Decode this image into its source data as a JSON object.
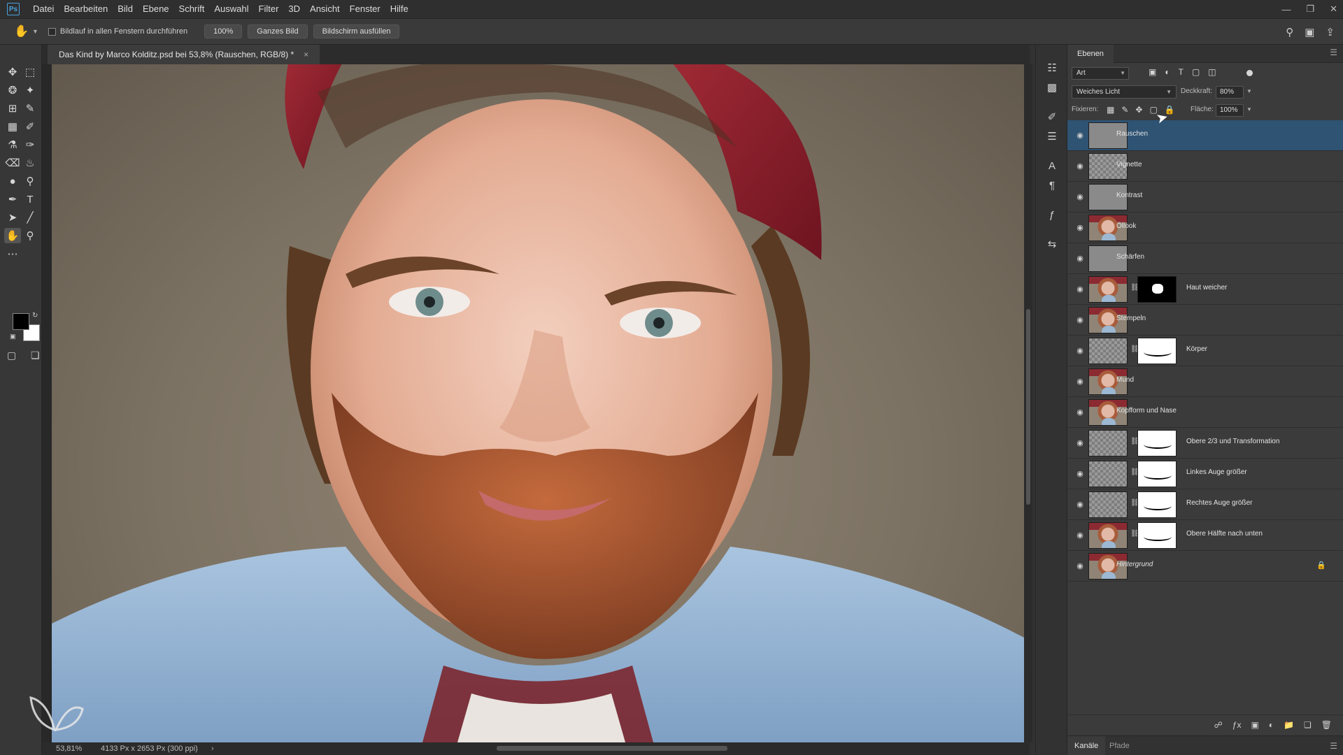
{
  "app": {
    "logo": "Ps"
  },
  "menu": [
    "Datei",
    "Bearbeiten",
    "Bild",
    "Ebene",
    "Schrift",
    "Auswahl",
    "Filter",
    "3D",
    "Ansicht",
    "Fenster",
    "Hilfe"
  ],
  "options": {
    "scroll_all_label": "Bildlauf in allen Fenstern durchführen",
    "zoom_btn": "100%",
    "fit_btn": "Ganzes Bild",
    "fill_btn": "Bildschirm ausfüllen"
  },
  "document": {
    "tab_title": "Das Kind by Marco Kolditz.psd bei 53,8% (Rauschen, RGB/8) *",
    "close": "×"
  },
  "status": {
    "zoom": "53,81%",
    "doc_info": "4133 Px x 2653 Px (300 ppi)"
  },
  "layers_panel": {
    "tab": "Ebenen",
    "filter_kind": "Art",
    "blend_mode": "Weiches Licht",
    "opacity_label": "Deckkraft:",
    "opacity_value": "80%",
    "lock_label": "Fixieren:",
    "fill_label": "Fläche:",
    "fill_value": "100%",
    "layers": [
      {
        "name": "Rauschen",
        "thumb": "gray",
        "mask": null,
        "selected": true
      },
      {
        "name": "Vignette",
        "thumb": "checker",
        "mask": null,
        "selected": false
      },
      {
        "name": "Kontrast",
        "thumb": "gray",
        "mask": null,
        "selected": false
      },
      {
        "name": "Öllook",
        "thumb": "portrait",
        "mask": null,
        "selected": false
      },
      {
        "name": "Schärfen",
        "thumb": "gray",
        "mask": null,
        "selected": false
      },
      {
        "name": "Haut weicher",
        "thumb": "portrait",
        "mask": "black",
        "selected": false
      },
      {
        "name": "Stempeln",
        "thumb": "portrait",
        "mask": null,
        "selected": false
      },
      {
        "name": "Körper",
        "thumb": "checker",
        "mask": "white",
        "selected": false
      },
      {
        "name": "Mund",
        "thumb": "portrait",
        "mask": null,
        "selected": false
      },
      {
        "name": "Kopfform und Nase",
        "thumb": "portrait",
        "mask": null,
        "selected": false
      },
      {
        "name": "Obere 2/3 und Transformation",
        "thumb": "checker",
        "mask": "white",
        "selected": false
      },
      {
        "name": "Linkes Auge größer",
        "thumb": "checker",
        "mask": "white",
        "selected": false
      },
      {
        "name": "Rechtes Auge größer",
        "thumb": "checker",
        "mask": "white",
        "selected": false
      },
      {
        "name": "Obere Hälfte nach unten",
        "thumb": "portrait",
        "mask": "white",
        "selected": false
      },
      {
        "name": "Hintergrund",
        "thumb": "portrait",
        "mask": null,
        "selected": false,
        "locked": true
      }
    ]
  },
  "bottom_tabs": [
    "Kanäle",
    "Pfade"
  ],
  "icons": {
    "hand_tool": "hand-icon",
    "search": "search-icon",
    "workspace": "workspace-icon",
    "share": "share-icon",
    "eye": "eye-icon",
    "lock": "lock-icon"
  }
}
